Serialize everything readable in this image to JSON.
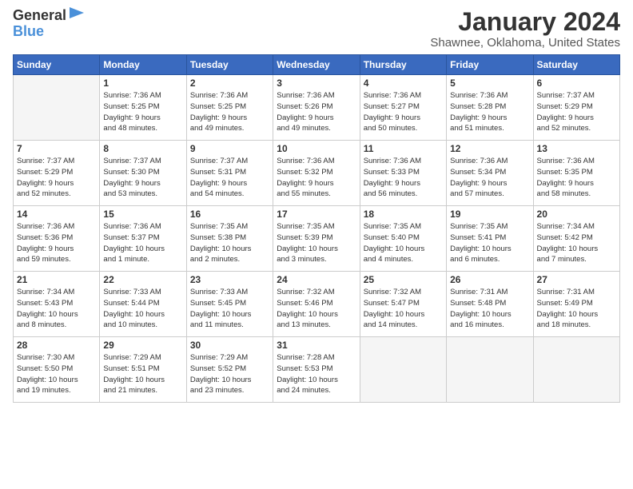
{
  "logo": {
    "line1": "General",
    "icon": "▶",
    "line2": "Blue"
  },
  "title": "January 2024",
  "location": "Shawnee, Oklahoma, United States",
  "days_of_week": [
    "Sunday",
    "Monday",
    "Tuesday",
    "Wednesday",
    "Thursday",
    "Friday",
    "Saturday"
  ],
  "weeks": [
    [
      {
        "day": "",
        "info": ""
      },
      {
        "day": "1",
        "info": "Sunrise: 7:36 AM\nSunset: 5:25 PM\nDaylight: 9 hours\nand 48 minutes."
      },
      {
        "day": "2",
        "info": "Sunrise: 7:36 AM\nSunset: 5:25 PM\nDaylight: 9 hours\nand 49 minutes."
      },
      {
        "day": "3",
        "info": "Sunrise: 7:36 AM\nSunset: 5:26 PM\nDaylight: 9 hours\nand 49 minutes."
      },
      {
        "day": "4",
        "info": "Sunrise: 7:36 AM\nSunset: 5:27 PM\nDaylight: 9 hours\nand 50 minutes."
      },
      {
        "day": "5",
        "info": "Sunrise: 7:36 AM\nSunset: 5:28 PM\nDaylight: 9 hours\nand 51 minutes."
      },
      {
        "day": "6",
        "info": "Sunrise: 7:37 AM\nSunset: 5:29 PM\nDaylight: 9 hours\nand 52 minutes."
      }
    ],
    [
      {
        "day": "7",
        "info": "Sunrise: 7:37 AM\nSunset: 5:29 PM\nDaylight: 9 hours\nand 52 minutes."
      },
      {
        "day": "8",
        "info": "Sunrise: 7:37 AM\nSunset: 5:30 PM\nDaylight: 9 hours\nand 53 minutes."
      },
      {
        "day": "9",
        "info": "Sunrise: 7:37 AM\nSunset: 5:31 PM\nDaylight: 9 hours\nand 54 minutes."
      },
      {
        "day": "10",
        "info": "Sunrise: 7:36 AM\nSunset: 5:32 PM\nDaylight: 9 hours\nand 55 minutes."
      },
      {
        "day": "11",
        "info": "Sunrise: 7:36 AM\nSunset: 5:33 PM\nDaylight: 9 hours\nand 56 minutes."
      },
      {
        "day": "12",
        "info": "Sunrise: 7:36 AM\nSunset: 5:34 PM\nDaylight: 9 hours\nand 57 minutes."
      },
      {
        "day": "13",
        "info": "Sunrise: 7:36 AM\nSunset: 5:35 PM\nDaylight: 9 hours\nand 58 minutes."
      }
    ],
    [
      {
        "day": "14",
        "info": "Sunrise: 7:36 AM\nSunset: 5:36 PM\nDaylight: 9 hours\nand 59 minutes."
      },
      {
        "day": "15",
        "info": "Sunrise: 7:36 AM\nSunset: 5:37 PM\nDaylight: 10 hours\nand 1 minute."
      },
      {
        "day": "16",
        "info": "Sunrise: 7:35 AM\nSunset: 5:38 PM\nDaylight: 10 hours\nand 2 minutes."
      },
      {
        "day": "17",
        "info": "Sunrise: 7:35 AM\nSunset: 5:39 PM\nDaylight: 10 hours\nand 3 minutes."
      },
      {
        "day": "18",
        "info": "Sunrise: 7:35 AM\nSunset: 5:40 PM\nDaylight: 10 hours\nand 4 minutes."
      },
      {
        "day": "19",
        "info": "Sunrise: 7:35 AM\nSunset: 5:41 PM\nDaylight: 10 hours\nand 6 minutes."
      },
      {
        "day": "20",
        "info": "Sunrise: 7:34 AM\nSunset: 5:42 PM\nDaylight: 10 hours\nand 7 minutes."
      }
    ],
    [
      {
        "day": "21",
        "info": "Sunrise: 7:34 AM\nSunset: 5:43 PM\nDaylight: 10 hours\nand 8 minutes."
      },
      {
        "day": "22",
        "info": "Sunrise: 7:33 AM\nSunset: 5:44 PM\nDaylight: 10 hours\nand 10 minutes."
      },
      {
        "day": "23",
        "info": "Sunrise: 7:33 AM\nSunset: 5:45 PM\nDaylight: 10 hours\nand 11 minutes."
      },
      {
        "day": "24",
        "info": "Sunrise: 7:32 AM\nSunset: 5:46 PM\nDaylight: 10 hours\nand 13 minutes."
      },
      {
        "day": "25",
        "info": "Sunrise: 7:32 AM\nSunset: 5:47 PM\nDaylight: 10 hours\nand 14 minutes."
      },
      {
        "day": "26",
        "info": "Sunrise: 7:31 AM\nSunset: 5:48 PM\nDaylight: 10 hours\nand 16 minutes."
      },
      {
        "day": "27",
        "info": "Sunrise: 7:31 AM\nSunset: 5:49 PM\nDaylight: 10 hours\nand 18 minutes."
      }
    ],
    [
      {
        "day": "28",
        "info": "Sunrise: 7:30 AM\nSunset: 5:50 PM\nDaylight: 10 hours\nand 19 minutes."
      },
      {
        "day": "29",
        "info": "Sunrise: 7:29 AM\nSunset: 5:51 PM\nDaylight: 10 hours\nand 21 minutes."
      },
      {
        "day": "30",
        "info": "Sunrise: 7:29 AM\nSunset: 5:52 PM\nDaylight: 10 hours\nand 23 minutes."
      },
      {
        "day": "31",
        "info": "Sunrise: 7:28 AM\nSunset: 5:53 PM\nDaylight: 10 hours\nand 24 minutes."
      },
      {
        "day": "",
        "info": ""
      },
      {
        "day": "",
        "info": ""
      },
      {
        "day": "",
        "info": ""
      }
    ]
  ]
}
